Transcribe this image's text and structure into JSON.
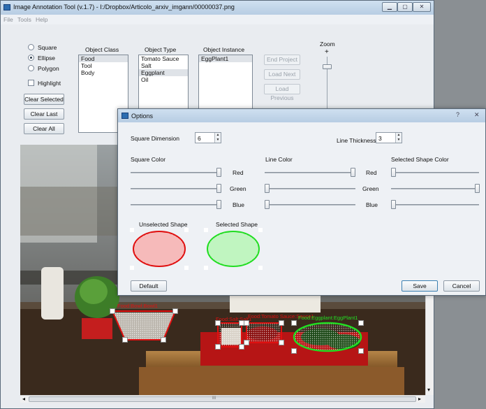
{
  "window": {
    "title": "Image Annotation Tool (v.1.7) - I:/Dropbox/Articolo_arxiv_imgann/00000037.png",
    "minimize": "▁",
    "maximize": "▢",
    "close": "✕"
  },
  "menu": [
    "File",
    "Tools",
    "Help"
  ],
  "shapes": {
    "square": "Square",
    "ellipse": "Ellipse",
    "polygon": "Polygon",
    "highlight": "Highlight",
    "selected": "Ellipse"
  },
  "buttons": {
    "clear_selected": "Clear Selected",
    "clear_last": "Clear Last",
    "clear_all": "Clear All",
    "end_project": "End Project",
    "load_next": "Load Next",
    "load_previous": "Load Previous"
  },
  "object_class": {
    "header": "Object Class",
    "items": [
      "Food",
      "Tool",
      "Body"
    ],
    "selected": "Food"
  },
  "object_type": {
    "header": "Object Type",
    "items": [
      "Tomato Sauce",
      "Salt",
      "Eggplant",
      "Oil"
    ],
    "selected": "Eggplant"
  },
  "object_instance": {
    "header": "Object Instance",
    "items": [
      "EggPlant1"
    ],
    "selected": "EggPlant1"
  },
  "zoom": {
    "label": "Zoom",
    "plus": "+"
  },
  "annotations": [
    {
      "label": "Food:Bowl:Bowl1",
      "color": "#e01010"
    },
    {
      "label": "Food:Salt:Salt1",
      "color": "#e01010"
    },
    {
      "label": "Food:Tomato Sauce:Sauce1",
      "color": "#e01010"
    },
    {
      "label": "Food:Eggplant:EggPlant1",
      "color": "#22dd22"
    }
  ],
  "scrollbar": {
    "left_arrow": "◂",
    "right_arrow": "▸",
    "down_arrow": "▾",
    "grip": "III"
  },
  "dialog": {
    "title": "Options",
    "help": "?",
    "close": "✕",
    "square_dimension_label": "Square Dimension",
    "square_dimension_value": "6",
    "line_thickness_label": "Line Thickness",
    "line_thickness_value": "3",
    "square_color": {
      "label": "Square Color",
      "red": 1.0,
      "green": 1.0,
      "blue": 1.0
    },
    "line_color": {
      "label": "Line Color",
      "red": 1.0,
      "green": 0.0,
      "blue": 0.0
    },
    "selected_shape_color": {
      "label": "Selected Shape Color",
      "red": 0.0,
      "green": 1.0,
      "blue": 0.0
    },
    "channels": {
      "red": "Red",
      "green": "Green",
      "blue": "Blue"
    },
    "unselected_shape_label": "Unselected Shape",
    "selected_shape_label": "Selected Shape",
    "default_button": "Default",
    "save_button": "Save",
    "cancel_button": "Cancel",
    "colors": {
      "unselected": "#e01010",
      "selected": "#22dd22"
    }
  }
}
